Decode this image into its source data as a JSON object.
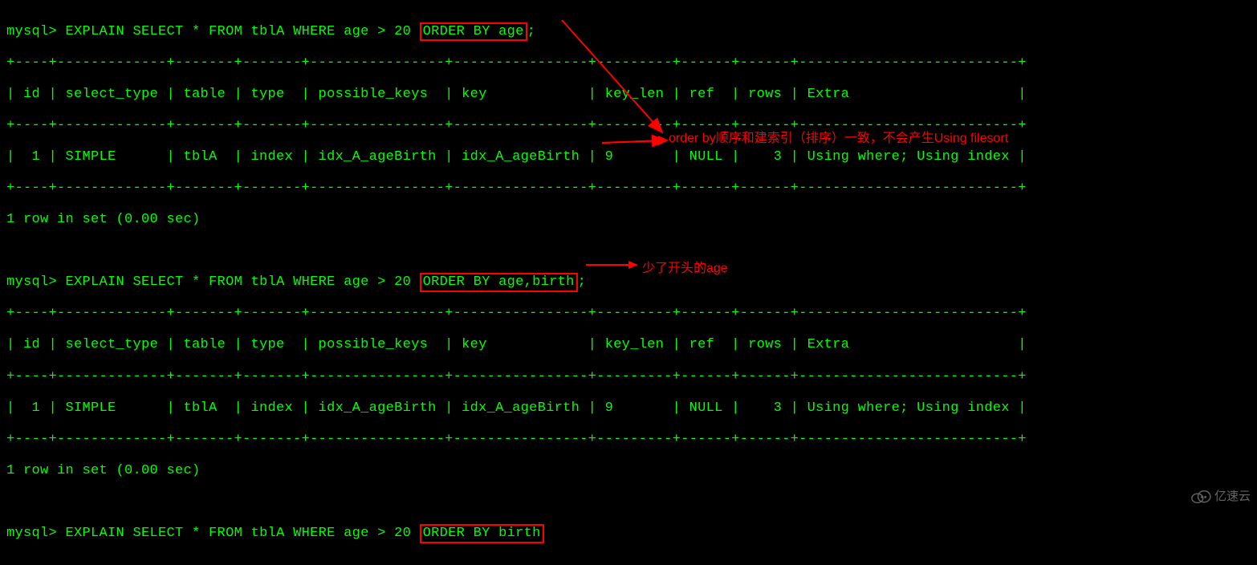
{
  "prompt": "mysql>",
  "queries": {
    "q1_pre": "EXPLAIN SELECT * FROM tblA WHERE age > 20 ",
    "q1_hl": "ORDER BY age",
    "q1_post": ";",
    "q2_pre": "EXPLAIN SELECT * FROM tblA WHERE age > 20 ",
    "q2_hl": "ORDER BY age,birth",
    "q2_post": ";",
    "q3_pre": "EXPLAIN SELECT * FROM tblA WHERE age > 20 ",
    "q3_hl": "ORDER BY birth",
    "q3_post": ""
  },
  "border": "+----+-------------+-------+-------+----------------+----------------+---------+------+------+--------------------------+",
  "headers": "| id | select_type | table | type  | possible_keys  | key            | key_len | ref  | rows | Extra                    |",
  "row1": "|  1 | SIMPLE      | tblA  | index | idx_A_ageBirth | idx_A_ageBirth | 9       | NULL |    3 | Using where; Using index |",
  "result_msg": "1 row in set (0.00 sec)",
  "annotations": {
    "main": "order by顺序和建索引（排序）一致，不会产生Using filesort",
    "partial": "少了开头的age"
  },
  "watermark": {
    "text": "亿速云"
  }
}
